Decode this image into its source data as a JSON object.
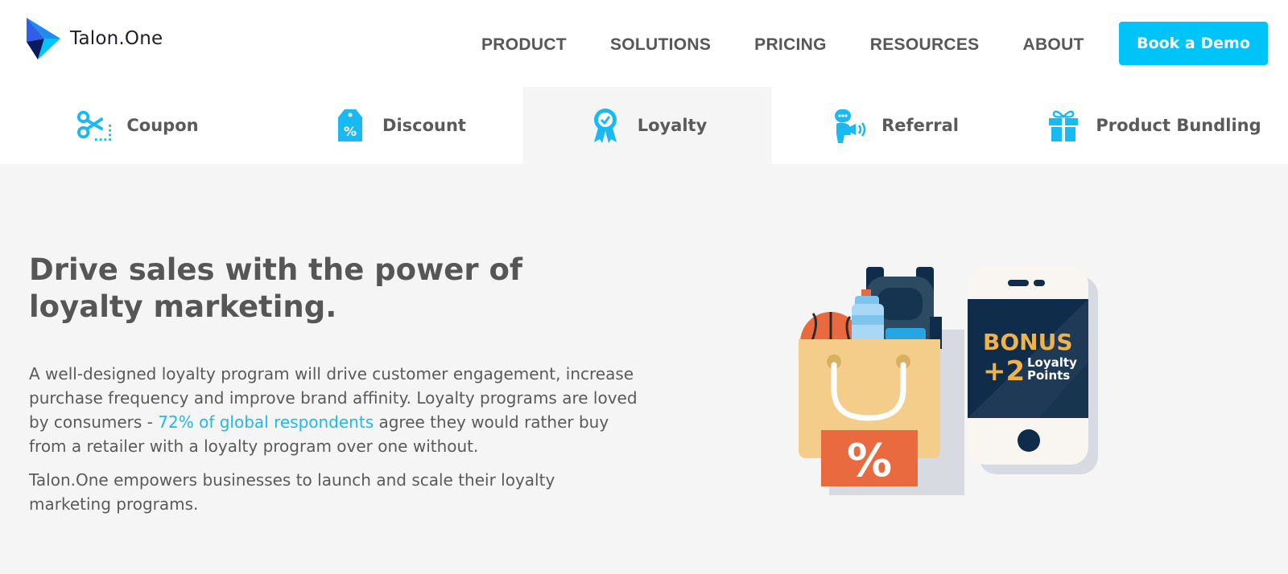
{
  "brand": {
    "name": "Talon.One"
  },
  "nav": {
    "items": [
      {
        "label": "PRODUCT"
      },
      {
        "label": "SOLUTIONS"
      },
      {
        "label": "PRICING"
      },
      {
        "label": "RESOURCES"
      },
      {
        "label": "ABOUT"
      }
    ],
    "cta_label": "Book a Demo"
  },
  "tabs": [
    {
      "label": "Coupon",
      "icon": "scissors-coupon-icon"
    },
    {
      "label": "Discount",
      "icon": "price-tag-percent-icon"
    },
    {
      "label": "Loyalty",
      "icon": "award-ribbon-icon",
      "active": true
    },
    {
      "label": "Referral",
      "icon": "speaker-person-icon"
    },
    {
      "label": "Product Bundling",
      "icon": "gift-box-icon"
    }
  ],
  "hero": {
    "title": "Drive sales with the power of loyalty marketing.",
    "p1_before": "A well-designed loyalty program will drive customer engagement, increase purchase frequency and improve brand affinity. Loyalty programs are loved by consumers - ",
    "p1_link": "72% of global respondents",
    "p1_after": " agree they would rather buy from a retailer with a loyalty program over one without.",
    "p2": "Talon.One empowers businesses to launch and scale their loyalty marketing programs."
  },
  "illustration": {
    "bag_label": "%",
    "phone_bonus": "BONUS",
    "phone_points": "+2",
    "phone_loyalty": "Loyalty",
    "phone_points_word": "Points"
  },
  "colors": {
    "accent": "#00c4f8",
    "text": "#565656",
    "link": "#1fb8ec",
    "bonus": "#f0b24a"
  }
}
